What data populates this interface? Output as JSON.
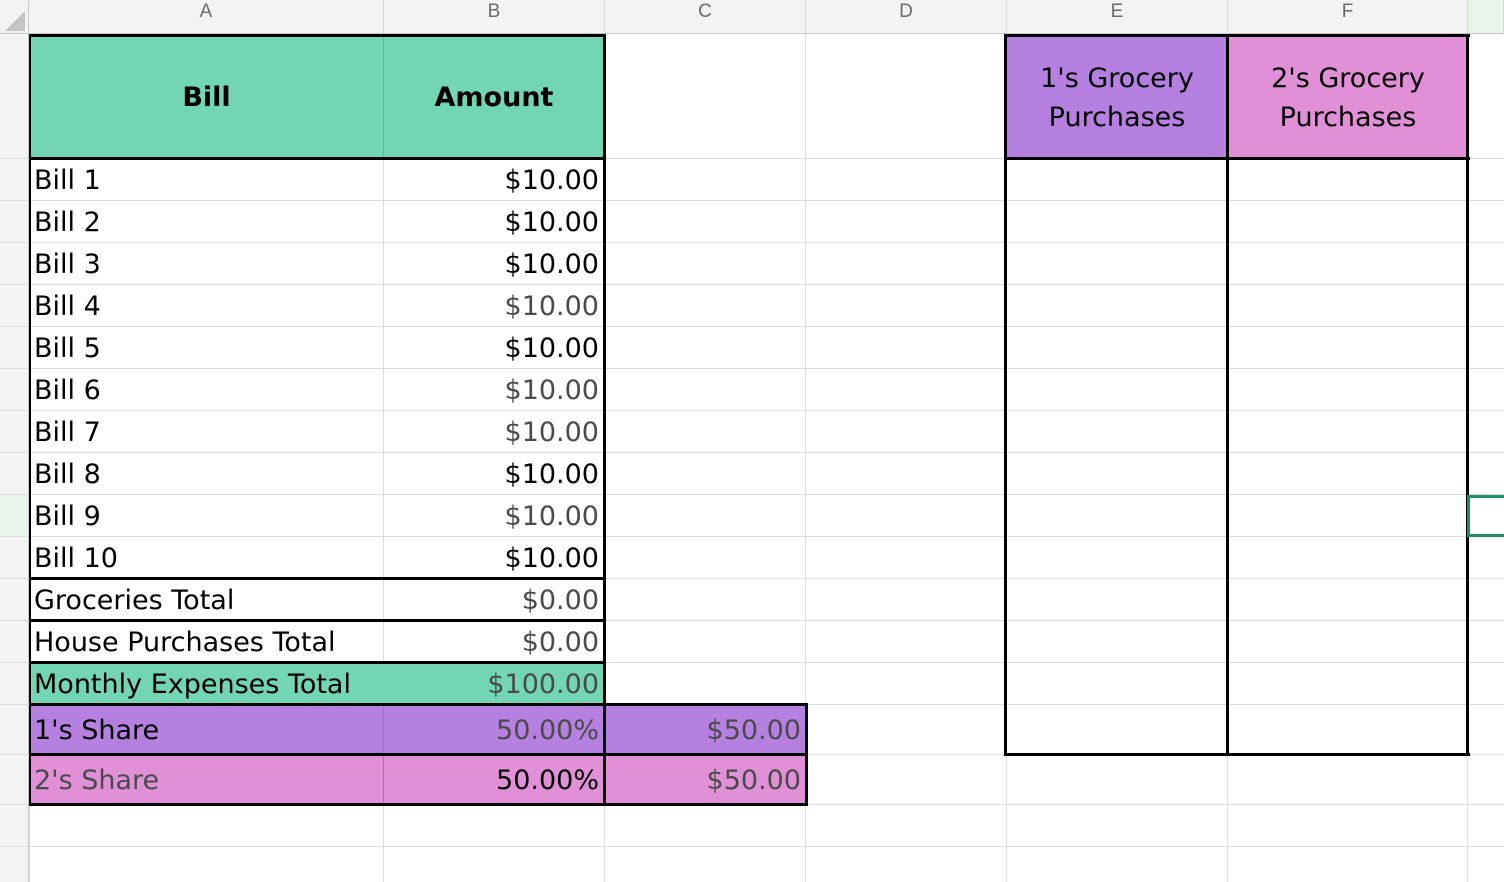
{
  "columns": [
    "A",
    "B",
    "C",
    "D",
    "E",
    "F"
  ],
  "bills_table": {
    "header": {
      "bill": "Bill",
      "amount": "Amount"
    },
    "rows": [
      {
        "label": "Bill 1",
        "amount": "$10.00"
      },
      {
        "label": "Bill 2",
        "amount": "$10.00"
      },
      {
        "label": "Bill 3",
        "amount": "$10.00"
      },
      {
        "label": "Bill 4",
        "amount": "$10.00"
      },
      {
        "label": "Bill 5",
        "amount": "$10.00"
      },
      {
        "label": "Bill 6",
        "amount": "$10.00"
      },
      {
        "label": "Bill 7",
        "amount": "$10.00"
      },
      {
        "label": "Bill 8",
        "amount": "$10.00"
      },
      {
        "label": "Bill 9",
        "amount": "$10.00"
      },
      {
        "label": "Bill 10",
        "amount": "$10.00"
      }
    ],
    "groceries_total": {
      "label": "Groceries Total",
      "amount": "$0.00"
    },
    "house_purchases_total": {
      "label": "House Purchases Total",
      "amount": "$0.00"
    },
    "monthly_expenses_total": {
      "label": "Monthly Expenses Total",
      "amount": "$100.00"
    }
  },
  "shares": [
    {
      "label": "1's Share",
      "percent": "50.00%",
      "amount": "$50.00"
    },
    {
      "label": "2's Share",
      "percent": "50.00%",
      "amount": "$50.00"
    }
  ],
  "grocery_table": {
    "person1_header": "1's Grocery Purchases",
    "person2_header": "2's Grocery Purchases"
  },
  "colors": {
    "header_green": "#72d5b3",
    "share1_purple": "#b580e0",
    "share2_pink": "#e190d8",
    "gridline": "#dadcdf",
    "active_cell_border": "#1f8f5f"
  }
}
